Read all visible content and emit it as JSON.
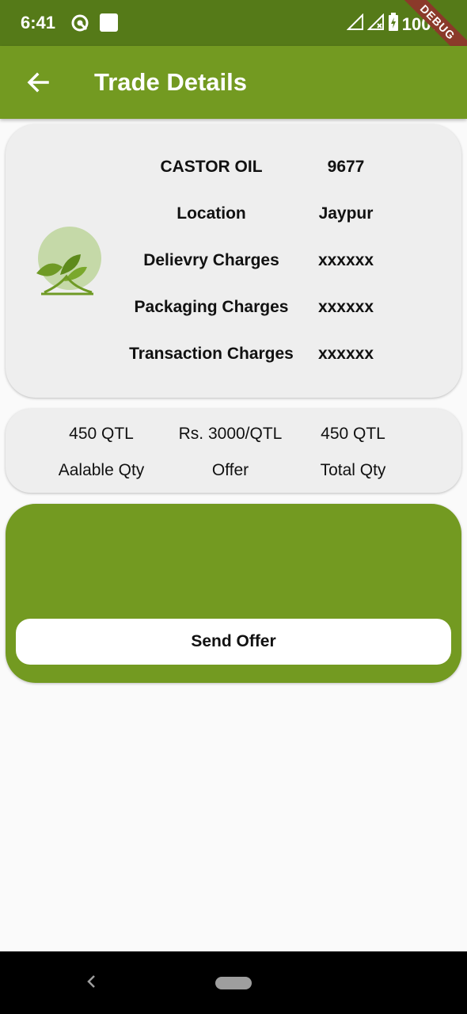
{
  "status_bar": {
    "time": "6:41",
    "battery": "100%",
    "debug_banner": "DEBUG"
  },
  "app_bar": {
    "title": "Trade Details",
    "back_icon": "arrow-back-icon"
  },
  "details": {
    "logo_icon": "leaf-sprout-logo",
    "rows": [
      {
        "label": "CASTOR OIL",
        "value": "9677"
      },
      {
        "label": "Location",
        "value": "Jaypur"
      },
      {
        "label": "Delievry Charges",
        "value": "xxxxxx"
      },
      {
        "label": "Packaging Charges",
        "value": "xxxxxx"
      },
      {
        "label": "Transaction Charges",
        "value": "xxxxxx"
      }
    ]
  },
  "quantities": {
    "available": {
      "value": "450 QTL",
      "label": "Aalable Qty"
    },
    "offer": {
      "value": "Rs. 3000/QTL",
      "label": "Offer"
    },
    "total": {
      "value": "450 QTL",
      "label": "Total Qty"
    }
  },
  "offer_section": {
    "send_label": "Send Offer"
  },
  "colors": {
    "primary": "#739a21",
    "status_bar": "#557a18",
    "card_background": "#eeeeee"
  }
}
